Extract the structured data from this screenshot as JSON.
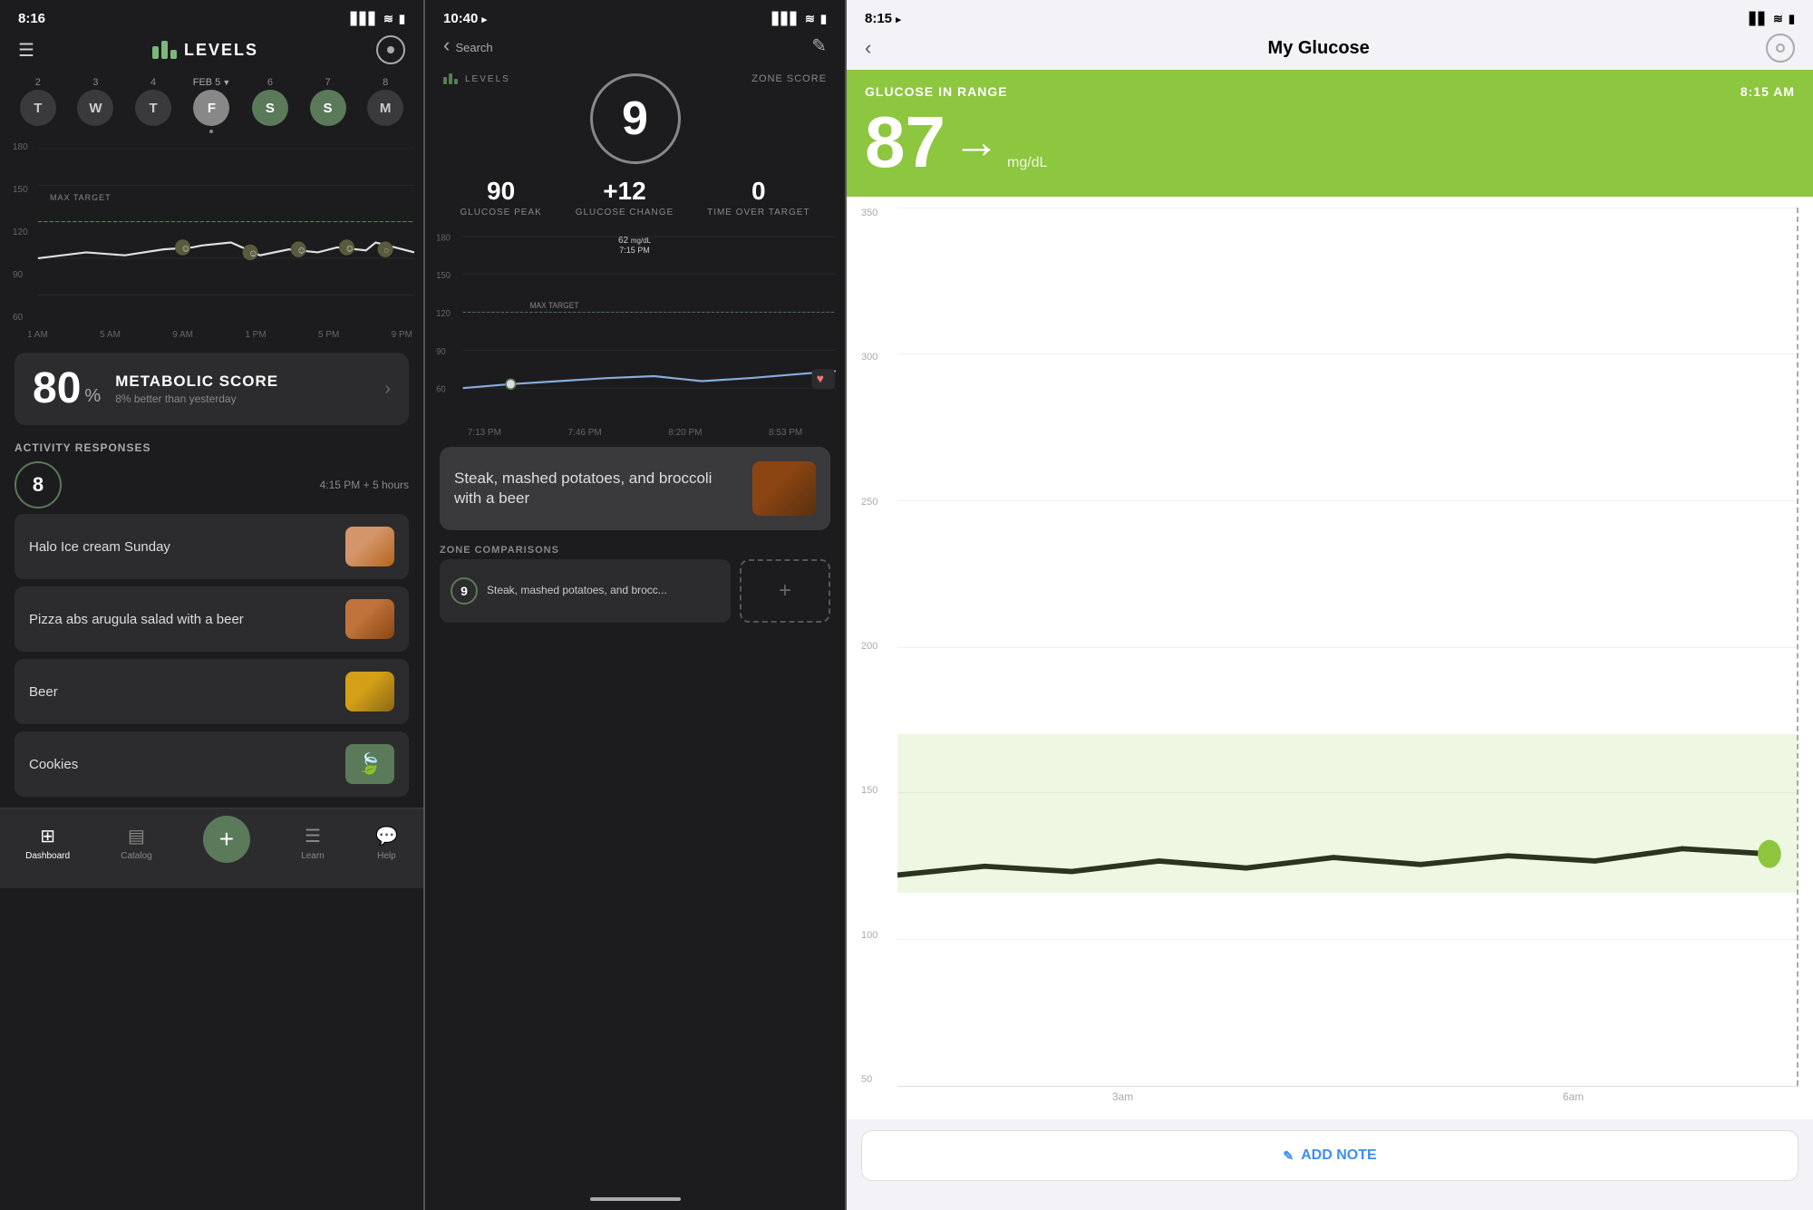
{
  "screen1": {
    "status": {
      "time": "8:16",
      "location_icon": "▸",
      "signal": "▋▋▋",
      "wifi": "wifi",
      "battery": "🔋"
    },
    "app_name": "LEVELS",
    "days": [
      {
        "num": "2",
        "label": "T",
        "active": false
      },
      {
        "num": "3",
        "label": "W",
        "active": false
      },
      {
        "num": "4",
        "label": "T",
        "active": false
      },
      {
        "num": "FEB 5",
        "label": "F",
        "active": true,
        "selected": true
      },
      {
        "num": "6",
        "label": "S",
        "active": true
      },
      {
        "num": "7",
        "label": "S",
        "active": true
      },
      {
        "num": "8",
        "label": "M",
        "active": false
      }
    ],
    "chart": {
      "y_labels": [
        "180",
        "150",
        "120",
        "90",
        "60"
      ],
      "x_labels": [
        "1 AM",
        "5 AM",
        "9 AM",
        "1 PM",
        "5 PM",
        "9 PM"
      ],
      "max_target_label": "MAX TARGET"
    },
    "metabolic_score": {
      "value": "80",
      "unit": "%",
      "title": "METABOLIC SCORE",
      "subtitle": "8% better than yesterday"
    },
    "activity_responses": {
      "title": "ACTIVITY RESPONSES",
      "score": "8",
      "time": "4:15 PM + 5 hours",
      "items": [
        {
          "name": "Halo Ice cream Sunday",
          "has_image": true
        },
        {
          "name": "Pizza abs arugula salad with a beer",
          "has_image": true
        },
        {
          "name": "Beer",
          "has_image": true
        },
        {
          "name": "Cookies",
          "has_image": true
        }
      ]
    },
    "bottom_nav": {
      "items": [
        {
          "label": "Dashboard",
          "icon": "⊞",
          "active": true
        },
        {
          "label": "Catalog",
          "icon": "▤"
        },
        {
          "label": "+",
          "icon": "+",
          "is_add": true
        },
        {
          "label": "Learn",
          "icon": "☰"
        },
        {
          "label": "Help",
          "icon": "💬"
        }
      ]
    }
  },
  "screen2": {
    "status": {
      "time": "10:40",
      "location_icon": "▸"
    },
    "nav": {
      "back": "‹",
      "search_label": "Search",
      "edit_icon": "✎"
    },
    "zone_score": {
      "label": "ZONE SCORE",
      "value": "9"
    },
    "stats": [
      {
        "value": "90",
        "label": "GLUCOSE PEAK"
      },
      {
        "value": "+12",
        "label": "GLUCOSE CHANGE"
      },
      {
        "value": "0",
        "label": "TIME OVER TARGET"
      }
    ],
    "tooltip": {
      "value": "62",
      "unit": "mg/dL",
      "time": "7:15 PM"
    },
    "chart": {
      "y_labels": [
        "180",
        "150",
        "120",
        "90",
        "60"
      ],
      "x_labels": [
        "7:13 PM",
        "7:46 PM",
        "8:20 PM",
        "8:53 PM"
      ],
      "max_target_label": "MAX TARGET"
    },
    "food_card": {
      "text": "Steak, mashed potatoes, and broccoli with a beer"
    },
    "zone_comparisons": {
      "title": "ZONE COMPARISONS",
      "items": [
        {
          "score": "9",
          "text": "Steak, mashed potatoes, and brocc..."
        }
      ],
      "add_label": "+"
    }
  },
  "screen3": {
    "status": {
      "time": "8:15",
      "location_icon": "▸"
    },
    "nav": {
      "back": "‹",
      "title": "My Glucose"
    },
    "glucose_header": {
      "label": "GLUCOSE IN RANGE",
      "time": "8:15 AM",
      "value": "87",
      "arrow": "→",
      "unit": "mg/dL"
    },
    "chart": {
      "y_labels": [
        "350",
        "300",
        "250",
        "200",
        "150",
        "100",
        "50"
      ],
      "x_labels": [
        "3am",
        "6am"
      ]
    },
    "add_note": {
      "icon": "✎",
      "label": "ADD NOTE"
    }
  }
}
